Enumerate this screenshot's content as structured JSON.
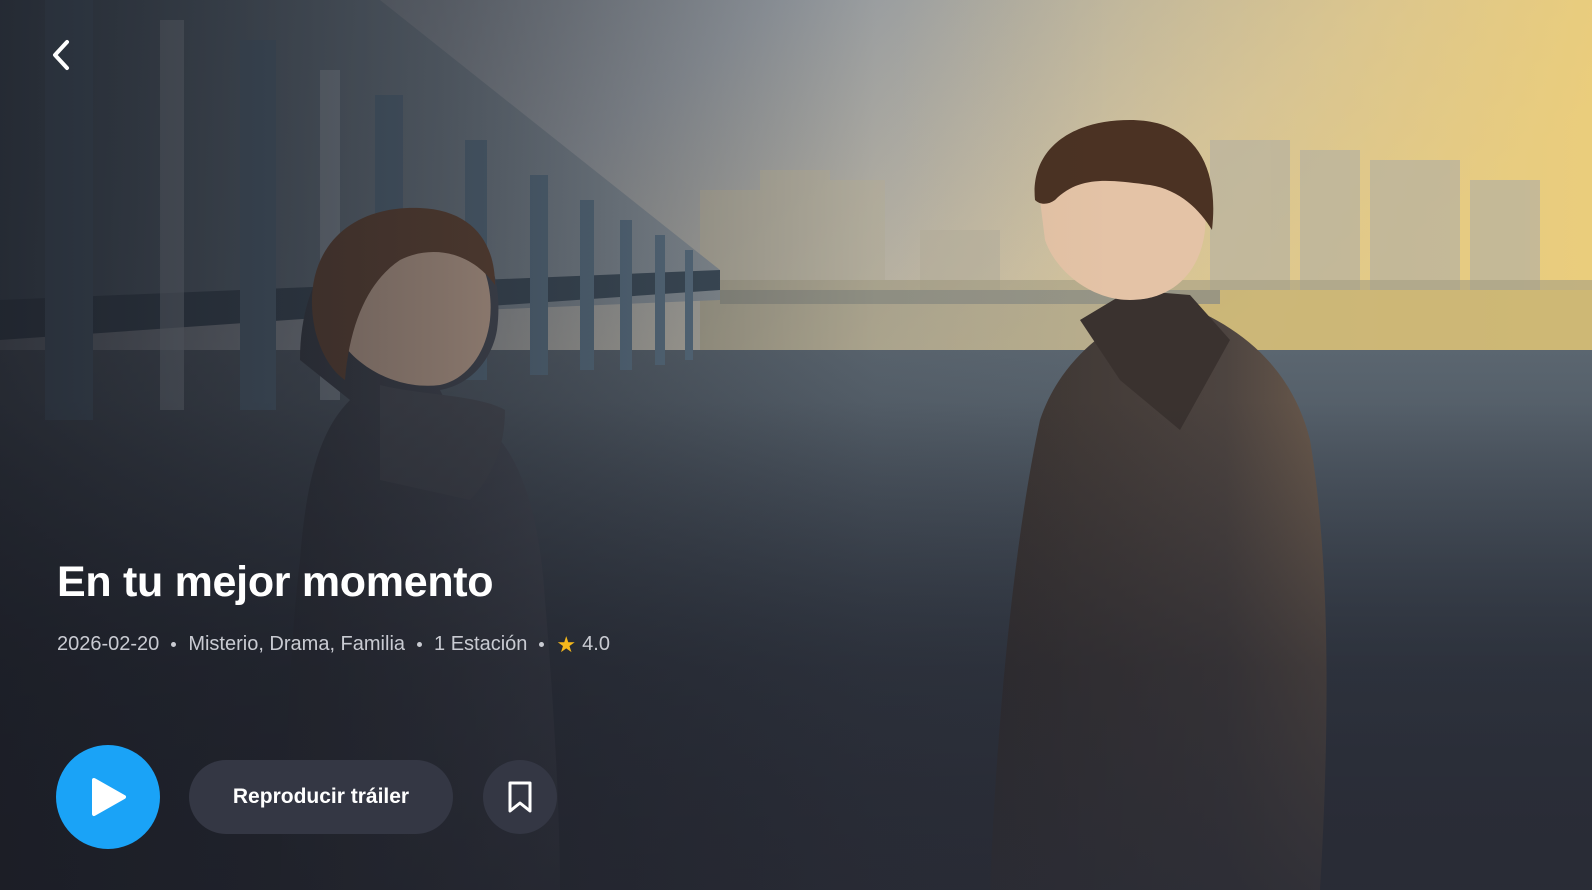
{
  "show": {
    "title": "En tu mejor momento",
    "release_date": "2026-02-20",
    "genres": "Misterio, Drama, Familia",
    "seasons": "1 Estación",
    "rating": "4.0"
  },
  "actions": {
    "trailer_label": "Reproducir tráiler"
  },
  "icons": {
    "back": "chevron-left-icon",
    "play": "play-icon",
    "bookmark": "bookmark-icon",
    "rating": "star-icon"
  },
  "colors": {
    "accent": "#1aa3f7",
    "secondary_button": "#343744",
    "star": "#f5b81c"
  }
}
